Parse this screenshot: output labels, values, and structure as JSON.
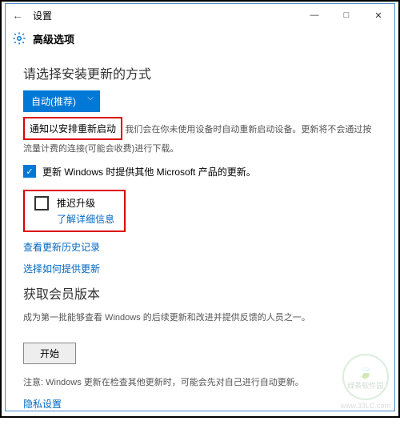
{
  "titlebar": {
    "back": "←",
    "title": "设置",
    "min": "—",
    "max": "□",
    "close": "✕"
  },
  "subheader": {
    "label": "高级选项"
  },
  "section1": {
    "heading": "请选择安装更新的方式",
    "dropdown": "自动(推荐)",
    "notify": "通知以安排重新启动",
    "desc_tail": "我们会在你未使用设备时自动重新启动设备。更新将不会通过按流量计费的连接(可能会收费)进行下载。",
    "ms_products": "更新 Windows 时提供其他 Microsoft 产品的更新。",
    "defer": "推迟升级",
    "learn_more": "了解详细信息",
    "history": "查看更新历史记录",
    "how_to": "选择如何提供更新"
  },
  "section2": {
    "heading": "获取会员版本",
    "desc": "成为第一批能够查看 Windows 的后续更新和改进并提供反馈的人员之一。",
    "start": "开始",
    "note": "注意: Windows 更新在检查其他更新时，可能会先对自己进行自动更新。",
    "privacy": "隐私设置"
  },
  "watermark": {
    "name": "绿茶软件园",
    "url": "www.33LC.com"
  }
}
